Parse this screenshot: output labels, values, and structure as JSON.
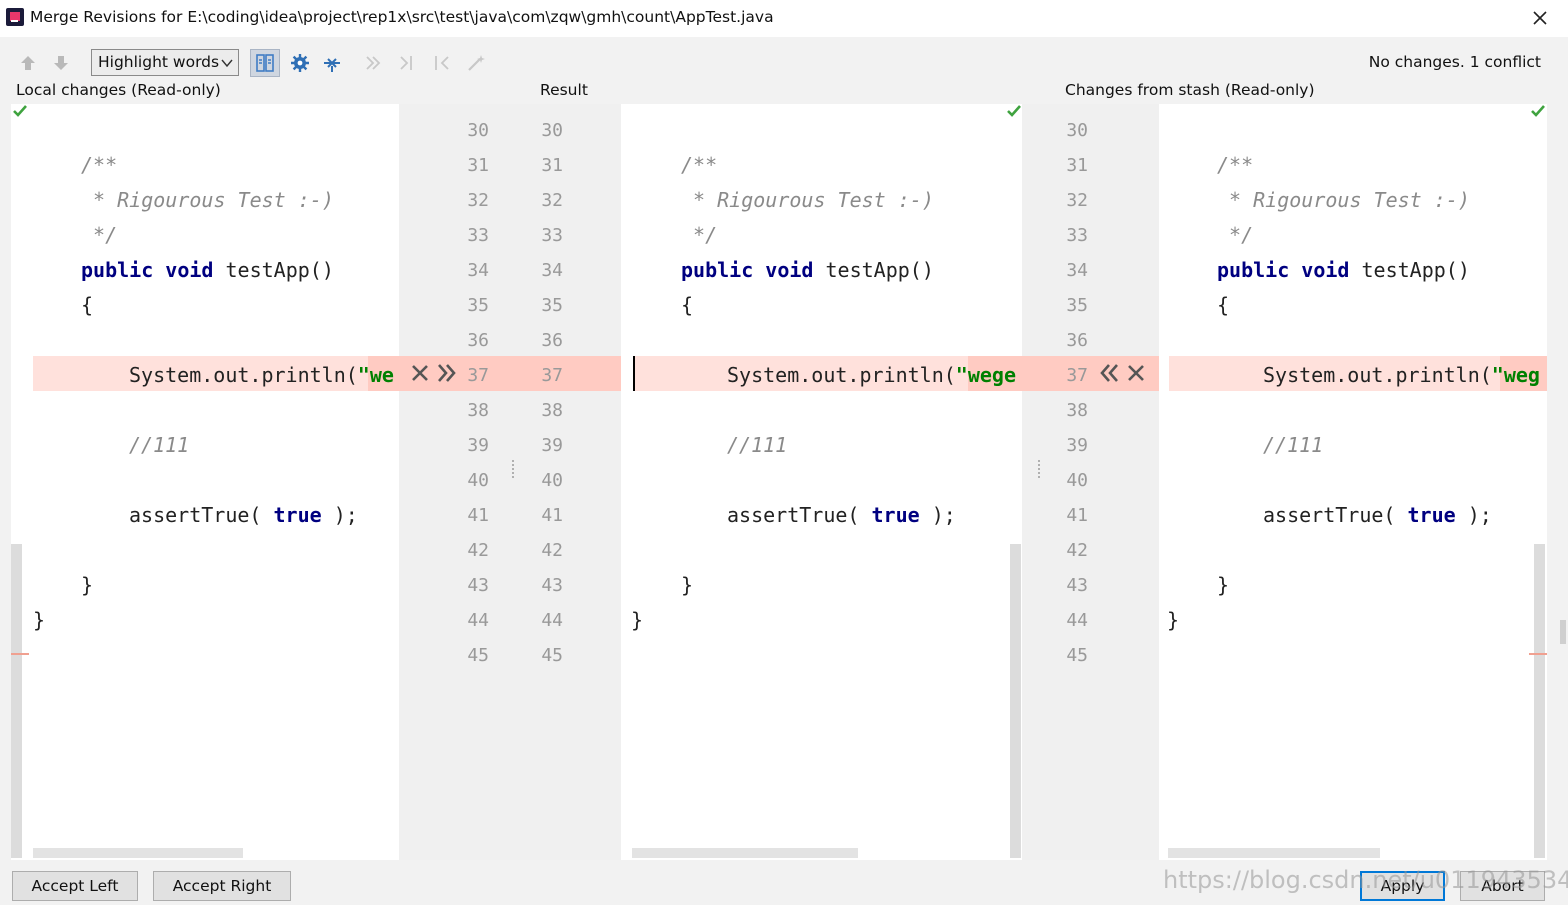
{
  "window": {
    "title": "Merge Revisions for E:\\coding\\idea\\project\\rep1x\\src\\test\\java\\com\\zqw\\gmh\\count\\AppTest.java",
    "icon": "intellij-idea-icon",
    "close_icon": "close-icon"
  },
  "toolbar": {
    "buttons": [
      "prev-difference-icon",
      "next-difference-icon",
      "side-by-side-viewer-icon",
      "settings-icon",
      "apply-non-conflicting-changes-icon",
      "apply-left-icon",
      "apply-right-icon",
      "ignore-icon",
      "resolve-magic-icon"
    ],
    "highlight_mode": "Highlight words",
    "status": "No changes. 1 conflict"
  },
  "panes": {
    "left_title": "Local changes (Read-only)",
    "center_title": "Result",
    "right_title": "Changes from stash (Read-only)"
  },
  "line_numbers": [
    "30",
    "31",
    "32",
    "33",
    "34",
    "35",
    "36",
    "37",
    "38",
    "39",
    "40",
    "41",
    "42",
    "43",
    "44",
    "45"
  ],
  "code": {
    "l30": "",
    "l31": "/**",
    "l32": " * Rigourous Test :-)",
    "l33": " */",
    "l34_kw": "public void",
    "l34_rest": " testApp()",
    "l35": "{",
    "l36": "",
    "l37_left_code": "System.out.println(",
    "l37_left_str": "\"we",
    "l37_center_str": "\"wege",
    "l37_right_str": "\"weg",
    "l39": "//111",
    "l41_a": "assertTrue( ",
    "l41_kw": "true",
    "l41_b": " );",
    "l43": "}",
    "l44": "}"
  },
  "buttons": {
    "accept_left": "Accept Left",
    "accept_right": "Accept Right",
    "apply": "Apply",
    "abort": "Abort"
  },
  "watermark": "https://blog.csdn.net/u011943534",
  "colors": {
    "conflict_bg": "#ffe1dc",
    "conflict_strong": "#ffcbc2",
    "keyword": "#000080",
    "string": "#008000",
    "check": "#3fa33f",
    "accent": "#0078d7"
  }
}
